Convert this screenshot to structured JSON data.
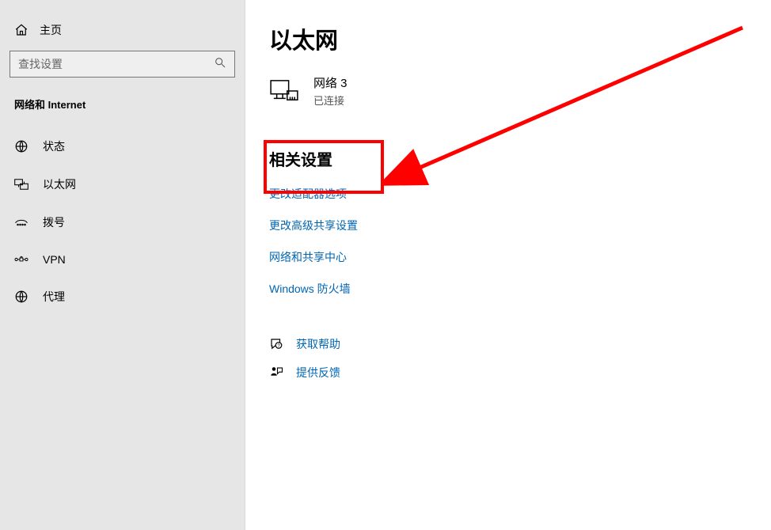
{
  "sidebar": {
    "home_label": "主页",
    "search_placeholder": "查找设置",
    "section_title": "网络和 Internet",
    "items": [
      {
        "icon": "status",
        "label": "状态"
      },
      {
        "icon": "ethernet",
        "label": "以太网"
      },
      {
        "icon": "dialup",
        "label": "拨号"
      },
      {
        "icon": "vpn",
        "label": "VPN"
      },
      {
        "icon": "proxy",
        "label": "代理"
      }
    ]
  },
  "main": {
    "title": "以太网",
    "network": {
      "name": "网络 3",
      "status": "已连接"
    },
    "related_title": "相关设置",
    "links": [
      "更改适配器选项",
      "更改高级共享设置",
      "网络和共享中心",
      "Windows 防火墙"
    ],
    "help_links": [
      {
        "icon": "help",
        "label": "获取帮助"
      },
      {
        "icon": "feedback",
        "label": "提供反馈"
      }
    ]
  }
}
